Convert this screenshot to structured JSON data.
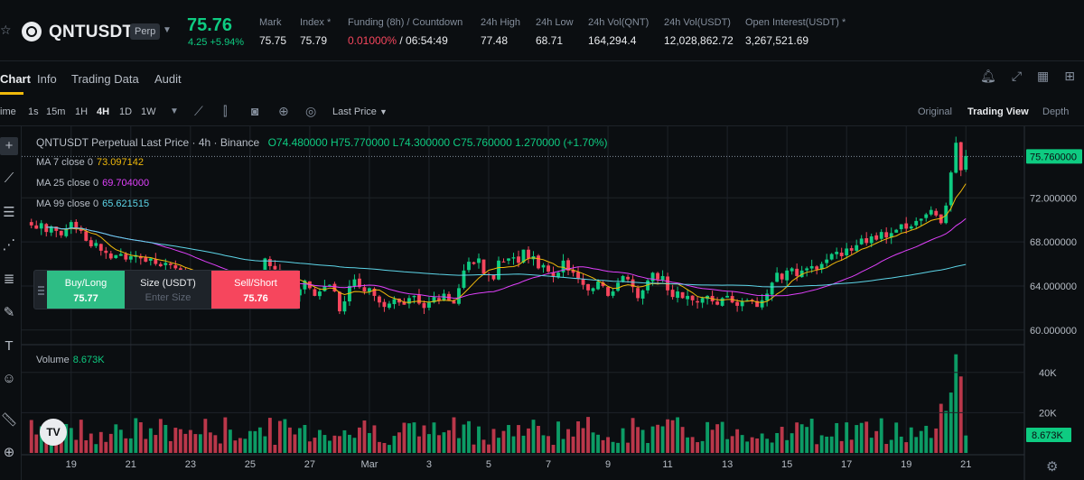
{
  "ticker": {
    "symbol": "QNTUSDT",
    "badge": "Perp",
    "last_price": "75.76",
    "change": "4.25 +5.94%",
    "stats": [
      {
        "label": "Mark",
        "value": "75.75"
      },
      {
        "label": "Index *",
        "value": "75.79"
      },
      {
        "label": "Funding (8h) / Countdown",
        "value_red": "0.01000%",
        "value_rest": " / 06:54:49"
      },
      {
        "label": "24h High",
        "value": "77.48"
      },
      {
        "label": "24h Low",
        "value": "68.71"
      },
      {
        "label": "24h Vol(QNT)",
        "value": "164,294.4"
      },
      {
        "label": "24h Vol(USDT)",
        "value": "12,028,862.72"
      },
      {
        "label": "Open Interest(USDT) *",
        "value": "3,267,521.69"
      }
    ]
  },
  "tabs": [
    "Chart",
    "Info",
    "Trading Data",
    "Audit"
  ],
  "toolbar": {
    "time_label": "ime",
    "intervals": [
      "1s",
      "15m",
      "1H",
      "4H",
      "1D",
      "1W"
    ],
    "active_interval": "4H",
    "price_type": "Last Price",
    "views": [
      "Original",
      "Trading View",
      "Depth"
    ],
    "active_view": "Trading View"
  },
  "legend": {
    "title": "QNTUSDT Perpetual Last Price · 4h · Binance",
    "ohlc": "O74.480000  H75.770000  L74.300000  C75.760000  1.270000 (+1.70%)"
  },
  "ma": [
    {
      "label": "MA 7 close 0",
      "value": "73.097142",
      "color": "#f0b90b"
    },
    {
      "label": "MA 25 close 0",
      "value": "69.704000",
      "color": "#e040fb"
    },
    {
      "label": "MA 99 close 0",
      "value": "65.621515",
      "color": "#5dd5e8"
    }
  ],
  "volume": {
    "label": "Volume",
    "value": "8.673K"
  },
  "order": {
    "buy_label": "Buy/Long",
    "buy_price": "75.77",
    "size_label": "Size (USDT)",
    "size_placeholder": "Enter Size",
    "sell_label": "Sell/Short",
    "sell_price": "75.76"
  },
  "chart_data": {
    "type": "candlestick",
    "price_axis": [
      "72.000000",
      "68.000000",
      "64.000000",
      "60.000000"
    ],
    "current_price": "75.760000",
    "volume_axis": [
      "40K",
      "20K"
    ],
    "current_volume": "8.673K",
    "date_ticks": [
      "19",
      "21",
      "23",
      "25",
      "27",
      "Mar",
      "3",
      "5",
      "7",
      "9",
      "11",
      "13",
      "15",
      "17",
      "19",
      "21"
    ],
    "ylim": [
      59,
      78
    ],
    "colors": {
      "up": "#0ecb81",
      "down": "#f6465d"
    },
    "close": [
      69.5,
      69.2,
      69.7,
      68.9,
      69.4,
      69.0,
      68.6,
      69.2,
      69.8,
      69.3,
      69.0,
      68.1,
      67.6,
      67.9,
      67.2,
      67.0,
      66.5,
      66.8,
      66.9,
      66.4,
      66.7,
      66.8,
      66.5,
      66.2,
      66.5,
      66.0,
      65.8,
      66.1,
      65.9,
      65.6,
      65.3,
      65.1,
      65.0,
      64.6,
      64.8,
      64.3,
      64.0,
      63.5,
      63.1,
      62.9,
      63.2,
      62.7,
      62.4,
      62.9,
      63.5,
      64.4,
      65.1,
      66.5,
      65.8,
      65.5,
      64.6,
      64.9,
      64.2,
      63.2,
      63.7,
      64.5,
      63.8,
      63.1,
      63.5,
      64.0,
      64.1,
      63.5,
      61.7,
      62.6,
      64.0,
      64.6,
      63.9,
      63.5,
      63.8,
      63.1,
      62.5,
      62.1,
      62.4,
      62.8,
      62.5,
      62.3,
      62.9,
      63.1,
      62.4,
      62.0,
      62.5,
      63.0,
      62.7,
      63.3,
      62.7,
      62.4,
      63.8,
      65.4,
      66.2,
      66.0,
      66.5,
      65.1,
      65.0,
      64.6,
      66.3,
      66.2,
      66.5,
      66.6,
      66.1,
      67.3,
      66.5,
      66.7,
      65.6,
      65.9,
      65.3,
      64.9,
      65.2,
      66.3,
      65.4,
      65.2,
      64.7,
      64.1,
      63.6,
      63.8,
      64.4,
      64.0,
      63.1,
      63.5,
      64.3,
      64.9,
      64.6,
      63.9,
      62.9,
      63.6,
      64.5,
      65.2,
      64.6,
      64.9,
      63.6,
      63.0,
      63.5,
      62.9,
      63.1,
      62.7,
      62.5,
      62.9,
      63.1,
      62.6,
      62.3,
      62.9,
      63.1,
      62.5,
      62.2,
      62.6,
      62.7,
      62.6,
      62.1,
      62.7,
      63.3,
      64.3,
      65.2,
      64.6,
      65.4,
      65.6,
      64.9,
      65.4,
      65.6,
      65.8,
      65.5,
      66.0,
      66.4,
      66.9,
      67.1,
      66.7,
      67.4,
      67.2,
      67.7,
      68.3,
      67.9,
      68.5,
      68.2,
      68.9,
      68.4,
      68.8,
      69.1,
      69.6,
      69.2,
      69.4,
      69.9,
      70.1,
      70.5,
      70.9,
      70.4,
      69.7,
      71.3,
      74.3,
      77.0,
      74.5,
      75.8
    ]
  }
}
